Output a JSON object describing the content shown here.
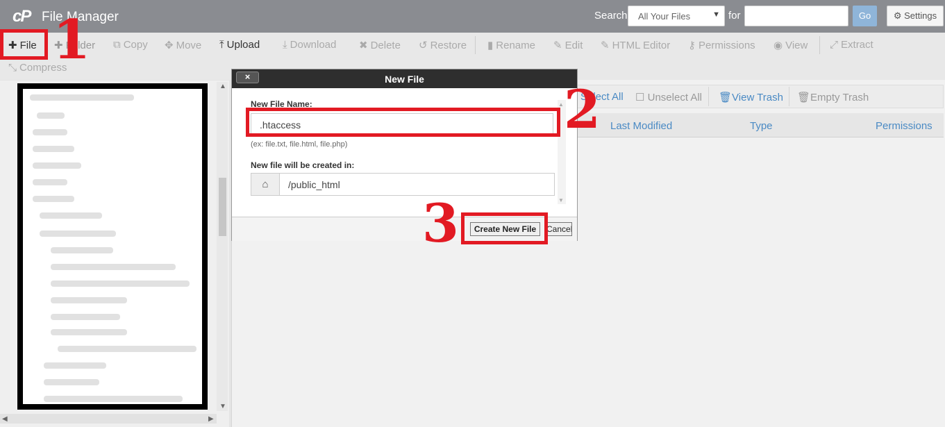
{
  "header": {
    "logo": "cP",
    "title": "File Manager",
    "search_label": "Search",
    "search_scope": "All Your Files",
    "for_label": "for",
    "search_value": "",
    "go_label": "Go",
    "settings_label": "Settings"
  },
  "toolbar": {
    "file": "File",
    "folder": "Folder",
    "copy": "Copy",
    "move": "Move",
    "upload": "Upload",
    "download": "Download",
    "delete": "Delete",
    "restore": "Restore",
    "rename": "Rename",
    "edit": "Edit",
    "html_editor": "HTML Editor",
    "permissions": "Permissions",
    "view": "View",
    "extract": "Extract",
    "compress": "Compress"
  },
  "list": {
    "select_all": "Select All",
    "unselect_all": "Unselect All",
    "view_trash": "View Trash",
    "empty_trash": "Empty Trash",
    "columns": [
      "Last Modified",
      "Type",
      "Permissions"
    ]
  },
  "dialog": {
    "title": "New File",
    "close_label": "×",
    "name_label": "New File Name:",
    "name_value": ".htaccess",
    "hint": "(ex: file.txt, file.html, file.php)",
    "location_label": "New file will be created in:",
    "location_value": "/public_html",
    "create_label": "Create New File",
    "cancel_label": "Cancel"
  },
  "annotations": [
    "1",
    "2",
    "3"
  ],
  "colors": {
    "header_bg": "#8a8c91",
    "annotation_red": "#e21a23",
    "link_blue": "#4a8ac4"
  }
}
